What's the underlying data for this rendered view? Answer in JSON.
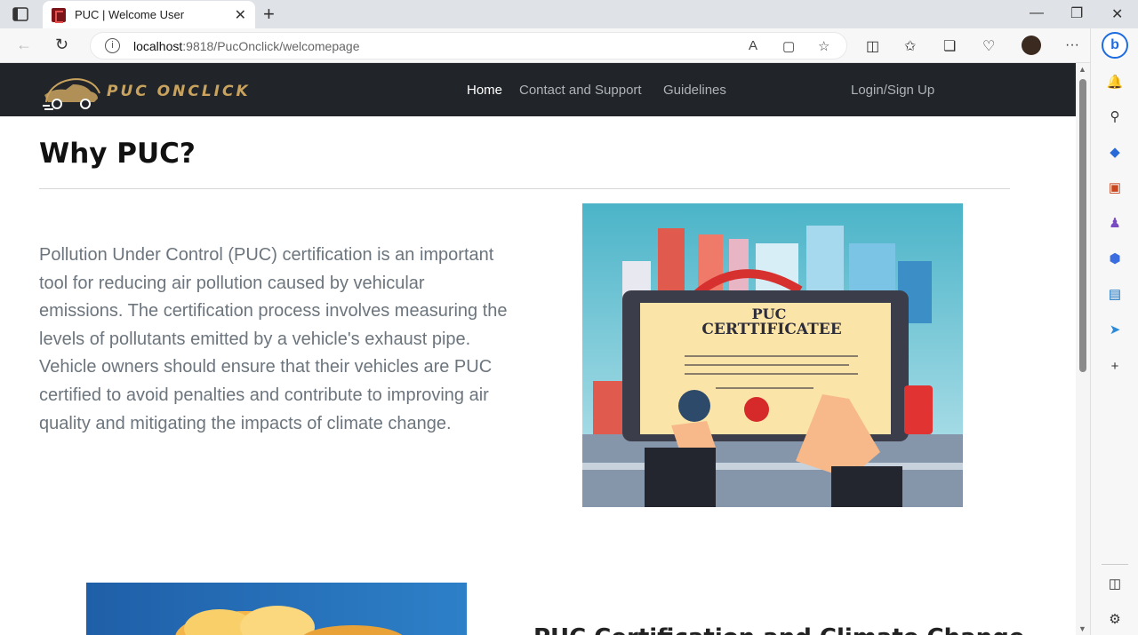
{
  "browser": {
    "tab_title": "PUC | Welcome User",
    "url_host": "localhost",
    "url_rest": ":9818/PucOnclick/welcomepage"
  },
  "site": {
    "brand": "PUC ONCLICK",
    "nav": {
      "home": "Home",
      "contact": "Contact and Support",
      "guidelines": "Guidelines",
      "login": "Login/Sign Up"
    }
  },
  "section1": {
    "heading": "Why PUC?",
    "paragraph": "Pollution Under Control (PUC) certification is an important tool for reducing air pollution caused by vehicular emissions. The certification process involves measuring the levels of pollutants emitted by a vehicle's exhaust pipe. Vehicle owners should ensure that their vehicles are PUC certified to avoid penalties and contribute to improving air quality and mitigating the impacts of climate change.",
    "image": {
      "line1": "PUC",
      "line2": "CERTTIFICATEE"
    }
  },
  "section2": {
    "heading": "PUC Certification and Climate Change"
  },
  "colors": {
    "navbar_bg": "#212529",
    "brand_gold": "#c9a35e",
    "text_muted": "#6c757d"
  }
}
